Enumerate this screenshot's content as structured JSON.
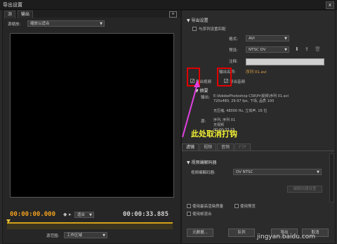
{
  "window": {
    "title": "导出设置",
    "close": "x"
  },
  "source_panel": {
    "tabs": [
      "源",
      "输出"
    ],
    "menu_icon": "≡",
    "scale_label": "源缩放:",
    "scale_value": "缩放以适合",
    "current_time": "00:00:00.000",
    "fit_value": "适合",
    "duration": "00:00:33.885",
    "range_label": "源范围:",
    "range_value": "工作区域"
  },
  "export_settings": {
    "heading": "导出设置",
    "match_sequence": "与序列设置匹配",
    "format_label": "格式:",
    "format_value": "AVI",
    "preset_label": "预设:",
    "preset_value": "NTSC DV",
    "comment_label": "注释:",
    "output_name_label": "输出名称:",
    "output_name_value": "序列 01.avi",
    "export_video": "导出视频",
    "export_audio": "导出音频"
  },
  "summary": {
    "heading": "摘要",
    "output_label": "输出:",
    "output_lines": [
      "E:\\AdobePhotoshop CS6\\Pr\\视频\\序列 01.avi",
      "720x480, 29.97 fps, 下场, 品质 100",
      "",
      "无压缩, 48000 Hz, 立体声, 16 位"
    ],
    "source_label": "源:",
    "source_lines": [
      "序列, 序列 01",
      "无视频",
      "00:00:33;25"
    ]
  },
  "annotation": "此处取消打钩",
  "tabs": [
    "滤镜",
    "视频",
    "音频",
    "FTP"
  ],
  "video_codec": {
    "heading": "视频编解码器",
    "codec_label": "视频编解码器:",
    "codec_value": "DV NTSC",
    "settings_button": "编解码器设置"
  },
  "options": {
    "max_render": "使用最高渲染质量",
    "use_preview": "使用预览",
    "frame_blend": "使用帧混合"
  },
  "buttons": {
    "metadata": "元数据...",
    "queue": "队列",
    "export": "导出",
    "cancel": "取消"
  },
  "watermark": "jingyan.baidu.com",
  "colors": {
    "timecode": "#f0a020",
    "annotation_text": "#f2ef35",
    "highlight_box": "#e00000",
    "arrow": "#e040e0"
  }
}
